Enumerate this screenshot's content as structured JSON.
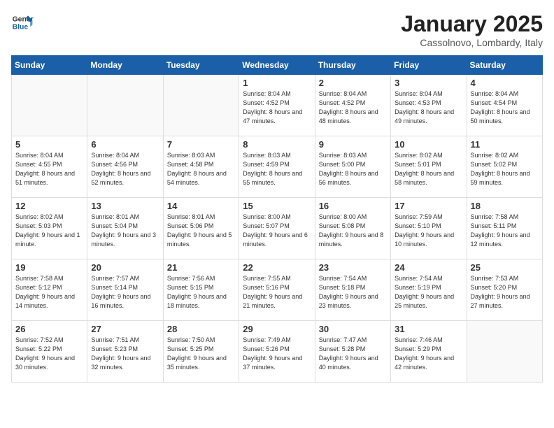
{
  "logo": {
    "line1": "General",
    "line2": "Blue"
  },
  "title": "January 2025",
  "subtitle": "Cassolnovo, Lombardy, Italy",
  "weekdays": [
    "Sunday",
    "Monday",
    "Tuesday",
    "Wednesday",
    "Thursday",
    "Friday",
    "Saturday"
  ],
  "weeks": [
    [
      {
        "day": "",
        "info": ""
      },
      {
        "day": "",
        "info": ""
      },
      {
        "day": "",
        "info": ""
      },
      {
        "day": "1",
        "info": "Sunrise: 8:04 AM\nSunset: 4:52 PM\nDaylight: 8 hours and 47 minutes."
      },
      {
        "day": "2",
        "info": "Sunrise: 8:04 AM\nSunset: 4:52 PM\nDaylight: 8 hours and 48 minutes."
      },
      {
        "day": "3",
        "info": "Sunrise: 8:04 AM\nSunset: 4:53 PM\nDaylight: 8 hours and 49 minutes."
      },
      {
        "day": "4",
        "info": "Sunrise: 8:04 AM\nSunset: 4:54 PM\nDaylight: 8 hours and 50 minutes."
      }
    ],
    [
      {
        "day": "5",
        "info": "Sunrise: 8:04 AM\nSunset: 4:55 PM\nDaylight: 8 hours and 51 minutes."
      },
      {
        "day": "6",
        "info": "Sunrise: 8:04 AM\nSunset: 4:56 PM\nDaylight: 8 hours and 52 minutes."
      },
      {
        "day": "7",
        "info": "Sunrise: 8:03 AM\nSunset: 4:58 PM\nDaylight: 8 hours and 54 minutes."
      },
      {
        "day": "8",
        "info": "Sunrise: 8:03 AM\nSunset: 4:59 PM\nDaylight: 8 hours and 55 minutes."
      },
      {
        "day": "9",
        "info": "Sunrise: 8:03 AM\nSunset: 5:00 PM\nDaylight: 8 hours and 56 minutes."
      },
      {
        "day": "10",
        "info": "Sunrise: 8:02 AM\nSunset: 5:01 PM\nDaylight: 8 hours and 58 minutes."
      },
      {
        "day": "11",
        "info": "Sunrise: 8:02 AM\nSunset: 5:02 PM\nDaylight: 8 hours and 59 minutes."
      }
    ],
    [
      {
        "day": "12",
        "info": "Sunrise: 8:02 AM\nSunset: 5:03 PM\nDaylight: 9 hours and 1 minute."
      },
      {
        "day": "13",
        "info": "Sunrise: 8:01 AM\nSunset: 5:04 PM\nDaylight: 9 hours and 3 minutes."
      },
      {
        "day": "14",
        "info": "Sunrise: 8:01 AM\nSunset: 5:06 PM\nDaylight: 9 hours and 5 minutes."
      },
      {
        "day": "15",
        "info": "Sunrise: 8:00 AM\nSunset: 5:07 PM\nDaylight: 9 hours and 6 minutes."
      },
      {
        "day": "16",
        "info": "Sunrise: 8:00 AM\nSunset: 5:08 PM\nDaylight: 9 hours and 8 minutes."
      },
      {
        "day": "17",
        "info": "Sunrise: 7:59 AM\nSunset: 5:10 PM\nDaylight: 9 hours and 10 minutes."
      },
      {
        "day": "18",
        "info": "Sunrise: 7:58 AM\nSunset: 5:11 PM\nDaylight: 9 hours and 12 minutes."
      }
    ],
    [
      {
        "day": "19",
        "info": "Sunrise: 7:58 AM\nSunset: 5:12 PM\nDaylight: 9 hours and 14 minutes."
      },
      {
        "day": "20",
        "info": "Sunrise: 7:57 AM\nSunset: 5:14 PM\nDaylight: 9 hours and 16 minutes."
      },
      {
        "day": "21",
        "info": "Sunrise: 7:56 AM\nSunset: 5:15 PM\nDaylight: 9 hours and 18 minutes."
      },
      {
        "day": "22",
        "info": "Sunrise: 7:55 AM\nSunset: 5:16 PM\nDaylight: 9 hours and 21 minutes."
      },
      {
        "day": "23",
        "info": "Sunrise: 7:54 AM\nSunset: 5:18 PM\nDaylight: 9 hours and 23 minutes."
      },
      {
        "day": "24",
        "info": "Sunrise: 7:54 AM\nSunset: 5:19 PM\nDaylight: 9 hours and 25 minutes."
      },
      {
        "day": "25",
        "info": "Sunrise: 7:53 AM\nSunset: 5:20 PM\nDaylight: 9 hours and 27 minutes."
      }
    ],
    [
      {
        "day": "26",
        "info": "Sunrise: 7:52 AM\nSunset: 5:22 PM\nDaylight: 9 hours and 30 minutes."
      },
      {
        "day": "27",
        "info": "Sunrise: 7:51 AM\nSunset: 5:23 PM\nDaylight: 9 hours and 32 minutes."
      },
      {
        "day": "28",
        "info": "Sunrise: 7:50 AM\nSunset: 5:25 PM\nDaylight: 9 hours and 35 minutes."
      },
      {
        "day": "29",
        "info": "Sunrise: 7:49 AM\nSunset: 5:26 PM\nDaylight: 9 hours and 37 minutes."
      },
      {
        "day": "30",
        "info": "Sunrise: 7:47 AM\nSunset: 5:28 PM\nDaylight: 9 hours and 40 minutes."
      },
      {
        "day": "31",
        "info": "Sunrise: 7:46 AM\nSunset: 5:29 PM\nDaylight: 9 hours and 42 minutes."
      },
      {
        "day": "",
        "info": ""
      }
    ]
  ]
}
